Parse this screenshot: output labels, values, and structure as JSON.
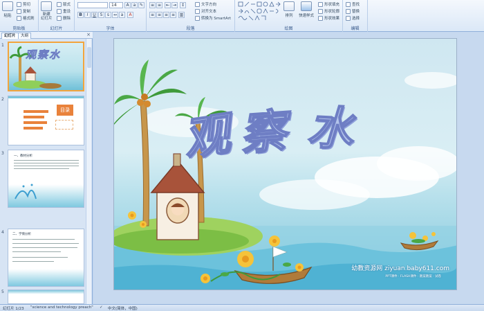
{
  "ribbon": {
    "groups": {
      "clipboard": "剪贴板",
      "slides": "幻灯片",
      "font": "字体",
      "paragraph": "段落",
      "drawing": "绘图",
      "editing": "编辑"
    },
    "clipboard": {
      "paste": "粘贴",
      "cut": "剪切",
      "copy": "复制",
      "format_painter": "格式刷"
    },
    "slides": {
      "new_slide": "新建\n幻灯片",
      "layout": "版式",
      "reset": "重设",
      "delete": "删除"
    },
    "font": {
      "size": "14"
    },
    "paragraph": {
      "text_direction": "文字方向",
      "align_text": "对齐文本",
      "smartart": "转换为 SmartArt"
    },
    "drawing": {
      "arrange": "排列",
      "quick_styles": "快速样式",
      "shape_fill": "形状填充",
      "shape_outline": "形状轮廓",
      "shape_effects": "形状效果"
    },
    "editing": {
      "find": "查找",
      "replace": "替换",
      "select": "选择"
    }
  },
  "leftpanel": {
    "tabs": [
      "幻灯片",
      "大纲"
    ],
    "close": "×",
    "slides": [
      {
        "num": "1",
        "title": "观察水"
      },
      {
        "num": "2",
        "title": "目录"
      },
      {
        "num": "3",
        "title": "一、教材分析"
      },
      {
        "num": "4",
        "title": "二、学情分析"
      },
      {
        "num": "5",
        "title": ""
      }
    ]
  },
  "slide": {
    "title_chars": [
      "观",
      "察",
      "水"
    ],
    "watermark_line1": "幼教资源网 ziyuan.baby611.com",
    "watermark_line2": "PPT课件 · FLASH课件 · 教案教案 · 试卷"
  },
  "statusbar": {
    "slide_info": "幻灯片 1/23",
    "theme": "\"science and technology preach\"",
    "language": "中文(简体，中国)"
  },
  "colors": {
    "ribbon_bg": "#dbe8f7",
    "title_fill": "#b3c4eb",
    "title_stroke": "#6e7ec4",
    "selected_thumb": "#f3a43c"
  }
}
